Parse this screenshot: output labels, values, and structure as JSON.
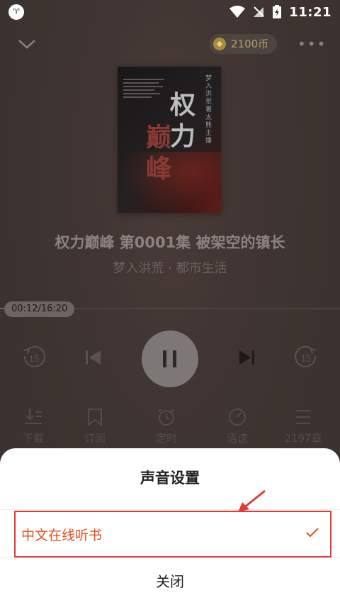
{
  "statusbar": {
    "time": "11:21",
    "app_icon_text": "♈"
  },
  "topbar": {
    "coins": "2100币",
    "more": "•••"
  },
  "book": {
    "cover_title_1": "权力",
    "cover_title_2": "巅峰",
    "cover_author": "梦入洪荒著太熊主播",
    "title": "权力巅峰 第0001集  被架空的镇长",
    "subtitle": "梦入洪荒 · 都市生活"
  },
  "player": {
    "time_display": "00:12/16:20",
    "progress": 0.012,
    "rewind_label": "15",
    "forward_label": "15"
  },
  "bottom_bar": {
    "download": "下载",
    "subscribe": "订阅",
    "timer": "定时",
    "speed": "语速",
    "chapters": "2197章"
  },
  "sheet": {
    "title": "声音设置",
    "option": "中文在线听书",
    "close": "关闭"
  },
  "colors": {
    "accent": "#e8501c",
    "highlight_border": "#e53935"
  }
}
